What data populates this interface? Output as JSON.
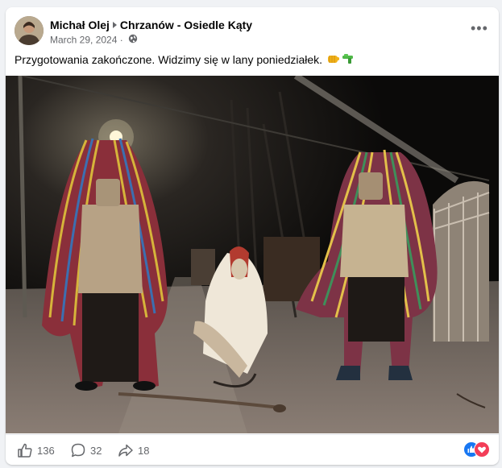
{
  "post": {
    "author": "Michał Olej",
    "group": "Chrzanów - Osiedle Kąty",
    "date": "March 29, 2024",
    "separator": "·",
    "caption": "Przygotowania zakończone. Widzimy się w lany poniedziałek.",
    "emojis": [
      "fist-emoji",
      "water-pistol-emoji"
    ],
    "photo": "Four people in folk costumes with colourful ribbon masks standing on a road at night under a street lamp"
  },
  "footer": {
    "likes": "136",
    "comments": "32",
    "shares": "18"
  },
  "colors": {
    "page_bg": "#f0f2f5",
    "card_bg": "#ffffff",
    "secondary_text": "#65676b",
    "like_blue": "#1877f2",
    "love_red": "#f33e58"
  },
  "icons": {
    "more": "more-icon",
    "globe": "globe-icon",
    "like": "like-icon",
    "comment": "comment-icon",
    "share": "share-icon"
  }
}
